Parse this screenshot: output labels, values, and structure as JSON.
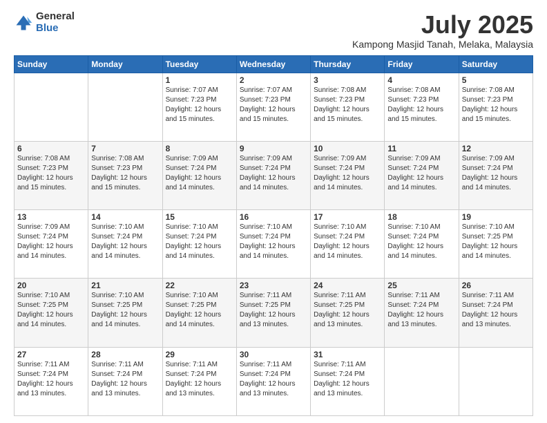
{
  "logo": {
    "general": "General",
    "blue": "Blue"
  },
  "title": {
    "month_year": "July 2025",
    "location": "Kampong Masjid Tanah, Melaka, Malaysia"
  },
  "headers": [
    "Sunday",
    "Monday",
    "Tuesday",
    "Wednesday",
    "Thursday",
    "Friday",
    "Saturday"
  ],
  "weeks": [
    [
      {
        "day": "",
        "sunrise": "",
        "sunset": "",
        "daylight": ""
      },
      {
        "day": "",
        "sunrise": "",
        "sunset": "",
        "daylight": ""
      },
      {
        "day": "1",
        "sunrise": "Sunrise: 7:07 AM",
        "sunset": "Sunset: 7:23 PM",
        "daylight": "Daylight: 12 hours and 15 minutes."
      },
      {
        "day": "2",
        "sunrise": "Sunrise: 7:07 AM",
        "sunset": "Sunset: 7:23 PM",
        "daylight": "Daylight: 12 hours and 15 minutes."
      },
      {
        "day": "3",
        "sunrise": "Sunrise: 7:08 AM",
        "sunset": "Sunset: 7:23 PM",
        "daylight": "Daylight: 12 hours and 15 minutes."
      },
      {
        "day": "4",
        "sunrise": "Sunrise: 7:08 AM",
        "sunset": "Sunset: 7:23 PM",
        "daylight": "Daylight: 12 hours and 15 minutes."
      },
      {
        "day": "5",
        "sunrise": "Sunrise: 7:08 AM",
        "sunset": "Sunset: 7:23 PM",
        "daylight": "Daylight: 12 hours and 15 minutes."
      }
    ],
    [
      {
        "day": "6",
        "sunrise": "Sunrise: 7:08 AM",
        "sunset": "Sunset: 7:23 PM",
        "daylight": "Daylight: 12 hours and 15 minutes."
      },
      {
        "day": "7",
        "sunrise": "Sunrise: 7:08 AM",
        "sunset": "Sunset: 7:23 PM",
        "daylight": "Daylight: 12 hours and 15 minutes."
      },
      {
        "day": "8",
        "sunrise": "Sunrise: 7:09 AM",
        "sunset": "Sunset: 7:24 PM",
        "daylight": "Daylight: 12 hours and 14 minutes."
      },
      {
        "day": "9",
        "sunrise": "Sunrise: 7:09 AM",
        "sunset": "Sunset: 7:24 PM",
        "daylight": "Daylight: 12 hours and 14 minutes."
      },
      {
        "day": "10",
        "sunrise": "Sunrise: 7:09 AM",
        "sunset": "Sunset: 7:24 PM",
        "daylight": "Daylight: 12 hours and 14 minutes."
      },
      {
        "day": "11",
        "sunrise": "Sunrise: 7:09 AM",
        "sunset": "Sunset: 7:24 PM",
        "daylight": "Daylight: 12 hours and 14 minutes."
      },
      {
        "day": "12",
        "sunrise": "Sunrise: 7:09 AM",
        "sunset": "Sunset: 7:24 PM",
        "daylight": "Daylight: 12 hours and 14 minutes."
      }
    ],
    [
      {
        "day": "13",
        "sunrise": "Sunrise: 7:09 AM",
        "sunset": "Sunset: 7:24 PM",
        "daylight": "Daylight: 12 hours and 14 minutes."
      },
      {
        "day": "14",
        "sunrise": "Sunrise: 7:10 AM",
        "sunset": "Sunset: 7:24 PM",
        "daylight": "Daylight: 12 hours and 14 minutes."
      },
      {
        "day": "15",
        "sunrise": "Sunrise: 7:10 AM",
        "sunset": "Sunset: 7:24 PM",
        "daylight": "Daylight: 12 hours and 14 minutes."
      },
      {
        "day": "16",
        "sunrise": "Sunrise: 7:10 AM",
        "sunset": "Sunset: 7:24 PM",
        "daylight": "Daylight: 12 hours and 14 minutes."
      },
      {
        "day": "17",
        "sunrise": "Sunrise: 7:10 AM",
        "sunset": "Sunset: 7:24 PM",
        "daylight": "Daylight: 12 hours and 14 minutes."
      },
      {
        "day": "18",
        "sunrise": "Sunrise: 7:10 AM",
        "sunset": "Sunset: 7:24 PM",
        "daylight": "Daylight: 12 hours and 14 minutes."
      },
      {
        "day": "19",
        "sunrise": "Sunrise: 7:10 AM",
        "sunset": "Sunset: 7:25 PM",
        "daylight": "Daylight: 12 hours and 14 minutes."
      }
    ],
    [
      {
        "day": "20",
        "sunrise": "Sunrise: 7:10 AM",
        "sunset": "Sunset: 7:25 PM",
        "daylight": "Daylight: 12 hours and 14 minutes."
      },
      {
        "day": "21",
        "sunrise": "Sunrise: 7:10 AM",
        "sunset": "Sunset: 7:25 PM",
        "daylight": "Daylight: 12 hours and 14 minutes."
      },
      {
        "day": "22",
        "sunrise": "Sunrise: 7:10 AM",
        "sunset": "Sunset: 7:25 PM",
        "daylight": "Daylight: 12 hours and 14 minutes."
      },
      {
        "day": "23",
        "sunrise": "Sunrise: 7:11 AM",
        "sunset": "Sunset: 7:25 PM",
        "daylight": "Daylight: 12 hours and 13 minutes."
      },
      {
        "day": "24",
        "sunrise": "Sunrise: 7:11 AM",
        "sunset": "Sunset: 7:25 PM",
        "daylight": "Daylight: 12 hours and 13 minutes."
      },
      {
        "day": "25",
        "sunrise": "Sunrise: 7:11 AM",
        "sunset": "Sunset: 7:24 PM",
        "daylight": "Daylight: 12 hours and 13 minutes."
      },
      {
        "day": "26",
        "sunrise": "Sunrise: 7:11 AM",
        "sunset": "Sunset: 7:24 PM",
        "daylight": "Daylight: 12 hours and 13 minutes."
      }
    ],
    [
      {
        "day": "27",
        "sunrise": "Sunrise: 7:11 AM",
        "sunset": "Sunset: 7:24 PM",
        "daylight": "Daylight: 12 hours and 13 minutes."
      },
      {
        "day": "28",
        "sunrise": "Sunrise: 7:11 AM",
        "sunset": "Sunset: 7:24 PM",
        "daylight": "Daylight: 12 hours and 13 minutes."
      },
      {
        "day": "29",
        "sunrise": "Sunrise: 7:11 AM",
        "sunset": "Sunset: 7:24 PM",
        "daylight": "Daylight: 12 hours and 13 minutes."
      },
      {
        "day": "30",
        "sunrise": "Sunrise: 7:11 AM",
        "sunset": "Sunset: 7:24 PM",
        "daylight": "Daylight: 12 hours and 13 minutes."
      },
      {
        "day": "31",
        "sunrise": "Sunrise: 7:11 AM",
        "sunset": "Sunset: 7:24 PM",
        "daylight": "Daylight: 12 hours and 13 minutes."
      },
      {
        "day": "",
        "sunrise": "",
        "sunset": "",
        "daylight": ""
      },
      {
        "day": "",
        "sunrise": "",
        "sunset": "",
        "daylight": ""
      }
    ]
  ]
}
